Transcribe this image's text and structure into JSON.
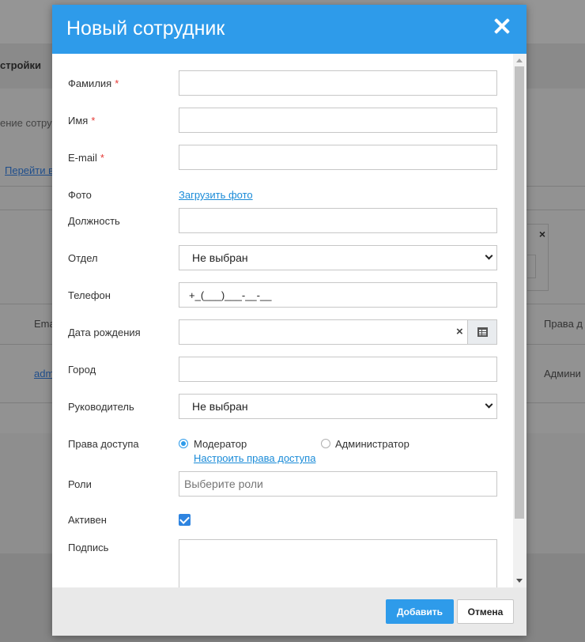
{
  "background": {
    "nav_text": "стройки",
    "desc_text": "ение сотру",
    "link_text": "Перейти в",
    "th_email": "Ema",
    "th_rights": "Права д",
    "td_email": "adm",
    "td_rights": "Админи",
    "panel_close": "×"
  },
  "modal": {
    "title": "Новый сотрудник",
    "required_mark": "*",
    "fields": {
      "last_name": {
        "label": "Фамилия",
        "value": ""
      },
      "first_name": {
        "label": "Имя",
        "value": ""
      },
      "email": {
        "label": "E-mail",
        "value": ""
      },
      "photo": {
        "label": "Фото",
        "link": "Загрузить фото"
      },
      "position": {
        "label": "Должность",
        "value": ""
      },
      "department": {
        "label": "Отдел",
        "selected": "Не выбран"
      },
      "phone": {
        "label": "Телефон",
        "value": "+_(___)___-__-__"
      },
      "birthdate": {
        "label": "Дата рождения",
        "value": "",
        "clear": "×"
      },
      "city": {
        "label": "Город",
        "value": ""
      },
      "manager": {
        "label": "Руководитель",
        "selected": "Не выбран"
      },
      "access": {
        "label": "Права доступа",
        "option_moderator": "Модератор",
        "option_admin": "Администратор",
        "selected": "Модератор",
        "configure_link": "Настроить права доступа"
      },
      "roles": {
        "label": "Роли",
        "placeholder": "Выберите роли"
      },
      "active": {
        "label": "Активен",
        "checked": true
      },
      "signature": {
        "label": "Подпись",
        "value": ""
      }
    },
    "buttons": {
      "add": "Добавить",
      "cancel": "Отмена"
    }
  },
  "colors": {
    "header": "#2e9bea",
    "required": "#e53935",
    "link": "#1a8bd8",
    "checkbox": "#2e84e0"
  },
  "icons": [
    "close-icon",
    "calendar-icon",
    "chevron-down-icon",
    "checkmark-icon"
  ]
}
